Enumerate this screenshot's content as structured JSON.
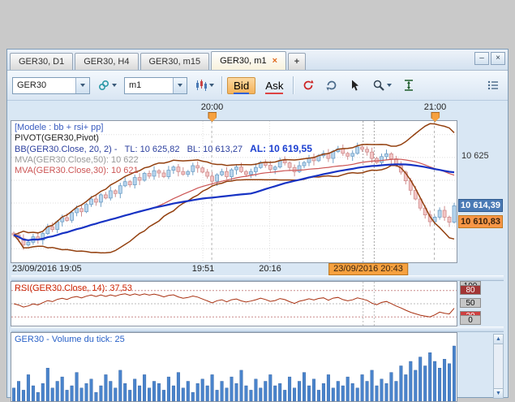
{
  "window": {
    "tabs": [
      {
        "label": "GER30, D1",
        "active": false
      },
      {
        "label": "GER30, H4",
        "active": false
      },
      {
        "label": "GER30, m15",
        "active": false
      },
      {
        "label": "GER30, m1",
        "active": true,
        "close_glyph": "×"
      }
    ],
    "new_tab_label": "+",
    "controls": {
      "minimize": "–",
      "close": "×"
    }
  },
  "toolbar": {
    "symbol_value": "GER30",
    "timeframe_value": "m1",
    "bid_label": "Bid",
    "ask_label": "Ask",
    "icons": [
      "link-icon",
      "chart-type-icon",
      "refresh-icon",
      "sync-icon",
      "pointer-icon",
      "zoom-icon",
      "vertical-scale-icon",
      "panel-menu-icon"
    ]
  },
  "chart": {
    "header_markers": [
      {
        "label": "20:00",
        "pos": 0.45
      },
      {
        "label": "21:00",
        "pos": 0.95
      }
    ],
    "overlay": {
      "model": "[Modele : bb + rsi+ pp]",
      "pivot": "PIVOT(GER30,Pivot)",
      "bb": "BB(GER30.Close, 20, 2) -",
      "bb_tl": "TL: 10 625,82",
      "bb_bl": "BL: 10 613,27",
      "bb_al": "AL: 10 619,55",
      "mva50": "MVA(GER30.Close,50): 10 622",
      "mva30": "MVA(GER30.Close,30): 10 621"
    },
    "y_axis": {
      "gridline_label": "10 625",
      "bid_badge": "10 614,39",
      "last_badge": "10 610,83"
    },
    "x_axis": {
      "ticks": [
        {
          "label": "23/09/2016 19:05",
          "pos": 0,
          "align": "left",
          "highlight": false
        },
        {
          "label": "19:51",
          "pos": 0.43,
          "align": "center",
          "highlight": false
        },
        {
          "label": "20:16",
          "pos": 0.58,
          "align": "center",
          "highlight": false
        },
        {
          "label": "23/09/2016 20:43",
          "pos": 0.8,
          "align": "center",
          "highlight": true
        }
      ]
    }
  },
  "rsi": {
    "label": "RSI(GER30.Close, 14): 37,53",
    "scale": [
      "100",
      "80",
      "50",
      "20",
      "0"
    ]
  },
  "volume": {
    "label": "GER30 - Volume du tick: 25"
  },
  "colors": {
    "accent_orange": "#f6a13f",
    "bid_badge_blue": "#4a7ab5",
    "last_badge_orange": "#f79646",
    "band_brown": "#93400f",
    "ma_blue": "#1733c4",
    "ma_red": "#cc5555",
    "rsi_red": "#a83010",
    "volume_blue": "#4a84cc",
    "up_candle": "#b9d6ee",
    "down_candle": "#f3c6c6",
    "rsi_level_dark_red": "#a23535",
    "rsi_level_red": "#cf4040",
    "rsi_level_gray": "#c6c6c6"
  },
  "chart_data": {
    "type": "candlestick",
    "title": "GER30 m1",
    "y_domain": [
      10602,
      10633
    ],
    "y_gridlines": [
      10605,
      10610,
      10615,
      10620,
      10625,
      10630
    ],
    "y_label_value": 10625,
    "bid_value": 10614.39,
    "last_value": 10610.83,
    "x_gridlines": [
      0.43,
      0.58
    ],
    "marker_positions": [
      0.45,
      0.95
    ],
    "cursor_lines": [
      0.79,
      0.815
    ],
    "closes": [
      10608.0,
      10607.2,
      10605.8,
      10606.4,
      10607.6,
      10606.9,
      10608.3,
      10609.8,
      10609.2,
      10610.9,
      10611.8,
      10611.2,
      10612.9,
      10613.8,
      10613.1,
      10614.7,
      10615.9,
      10615.2,
      10616.8,
      10616.1,
      10617.7,
      10617.1,
      10618.8,
      10619.7,
      10619.0,
      10620.6,
      10620.0,
      10621.5,
      10620.9,
      10622.1,
      10621.6,
      10620.8,
      10622.2,
      10622.9,
      10621.9,
      10621.3,
      10621.9,
      10623.2,
      10622.7,
      10621.8,
      10620.9,
      10619.8,
      10621.2,
      10621.9,
      10620.8,
      10622.3,
      10622.9,
      10621.9,
      10621.3,
      10621.9,
      10622.8,
      10623.9,
      10623.3,
      10622.4,
      10622.9,
      10624.3,
      10623.8,
      10622.8,
      10621.9,
      10623.2,
      10623.9,
      10624.9,
      10624.3,
      10625.4,
      10625.9,
      10624.8,
      10626.3,
      10626.9,
      10625.9,
      10625.3,
      10625.9,
      10627.3,
      10626.8,
      10626.2,
      10624.8,
      10623.9,
      10625.2,
      10625.8,
      10624.7,
      10623.2,
      10621.8,
      10619.9,
      10617.8,
      10615.9,
      10613.9,
      10612.4,
      10610.9,
      10611.9,
      10613.4,
      10611.9,
      10610.8,
      10614.4
    ],
    "volumes": [
      6,
      9,
      5,
      12,
      7,
      4,
      8,
      15,
      6,
      9,
      11,
      5,
      7,
      13,
      6,
      8,
      10,
      4,
      7,
      12,
      9,
      6,
      14,
      8,
      5,
      10,
      7,
      12,
      6,
      9,
      8,
      5,
      11,
      7,
      13,
      6,
      9,
      4,
      8,
      10,
      7,
      12,
      5,
      9,
      6,
      11,
      8,
      14,
      7,
      5,
      10,
      6,
      9,
      12,
      7,
      8,
      5,
      11,
      6,
      9,
      13,
      7,
      10,
      5,
      8,
      12,
      6,
      9,
      7,
      11,
      8,
      6,
      12,
      9,
      14,
      7,
      10,
      8,
      13,
      9,
      16,
      12,
      18,
      14,
      20,
      16,
      22,
      18,
      15,
      19,
      17,
      25
    ],
    "indicators": {
      "bollinger": {
        "period": 20,
        "deviation": 2,
        "tl": 10625.82,
        "bl": 10613.27,
        "al": 10619.55
      },
      "mva50": 10622,
      "mva30": 10621,
      "rsi": {
        "period": 14,
        "value": 37.53
      },
      "volume_tick": 25
    },
    "rsi_gridlines": [
      80,
      50,
      20
    ],
    "rsi_scale_values": [
      100,
      80,
      50,
      20,
      0
    ],
    "volume_max": 25
  }
}
